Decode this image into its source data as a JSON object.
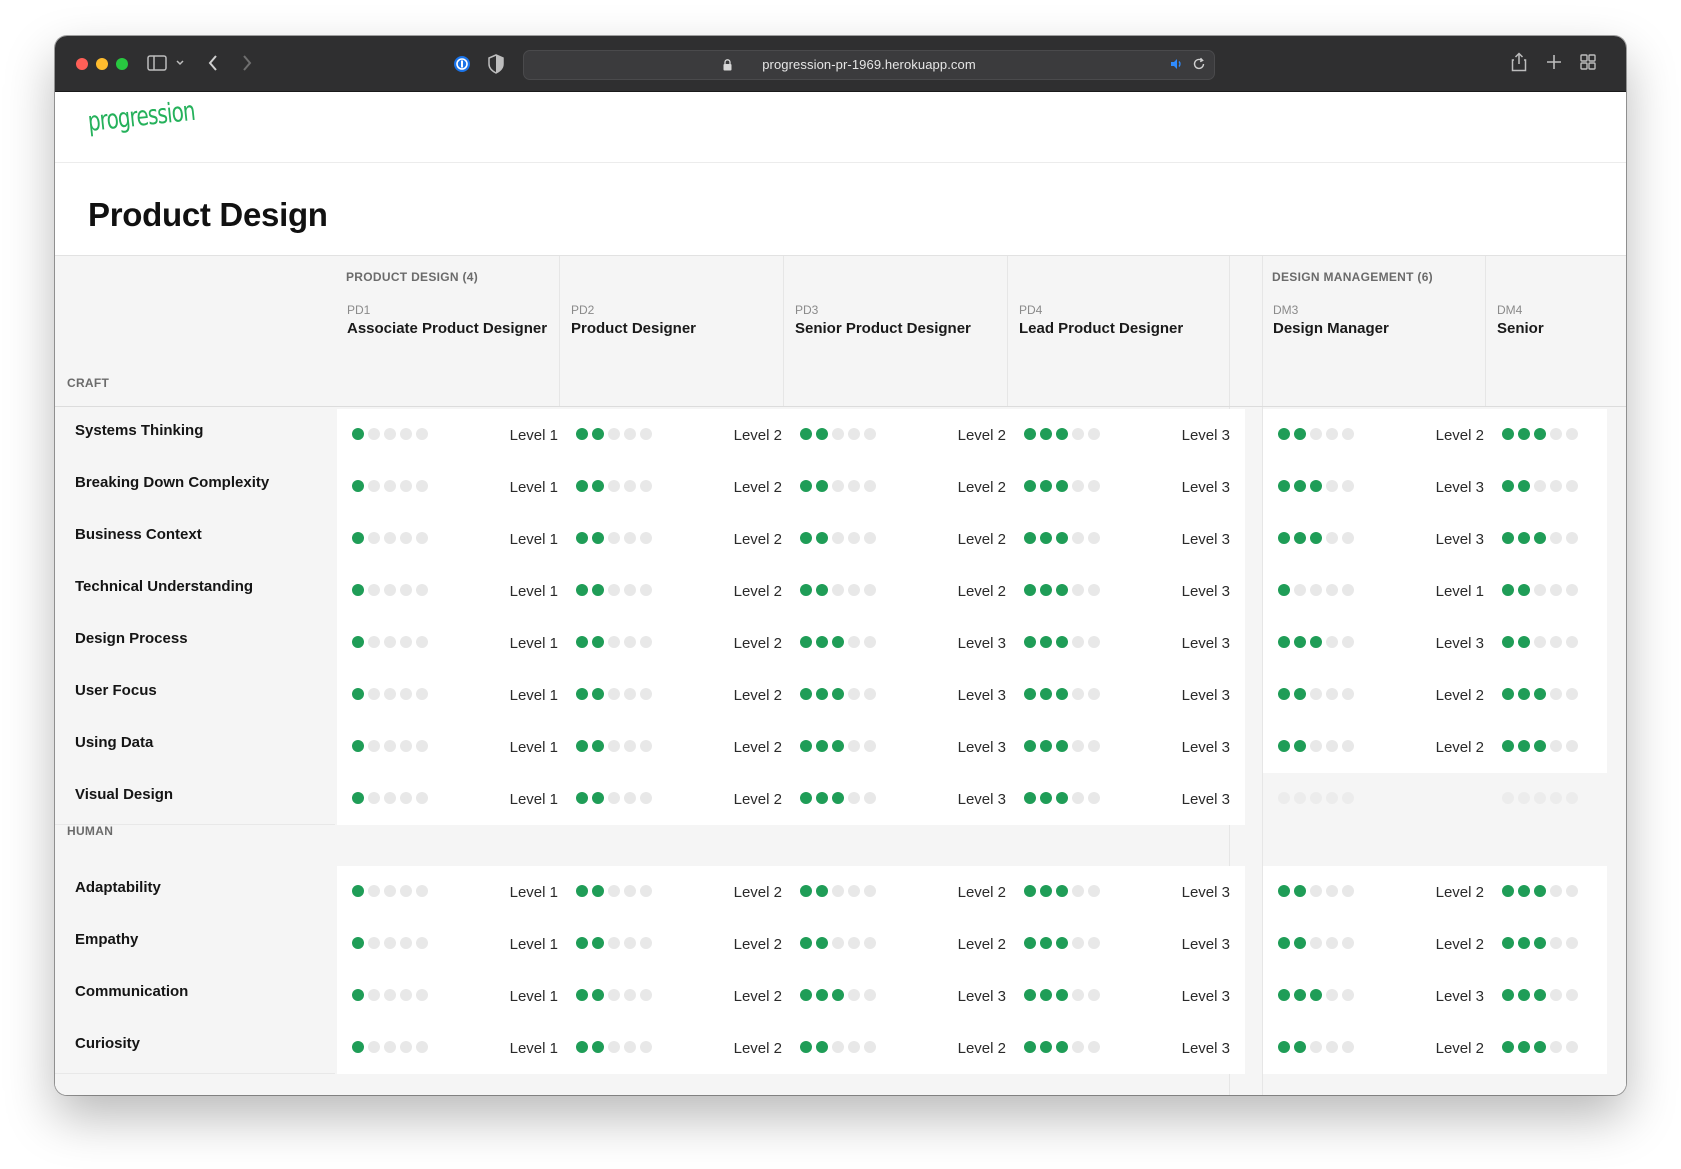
{
  "browser": {
    "url": "progression-pr-1969.herokuapp.com"
  },
  "app": {
    "logo": "progression",
    "page_title": "Product Design"
  },
  "colors": {
    "accent_green": "#1f9d57",
    "dot_off": "#e8e8e8",
    "logo_green": "#25b15b"
  },
  "groups": [
    {
      "label": "PRODUCT DESIGN (4)"
    },
    {
      "label": "DESIGN MANAGEMENT (6)"
    }
  ],
  "columns": [
    {
      "code": "PD1",
      "title": "Associate Product Designer"
    },
    {
      "code": "PD2",
      "title": "Product Designer"
    },
    {
      "code": "PD3",
      "title": "Senior Product Designer"
    },
    {
      "code": "PD4",
      "title": "Lead Product Designer"
    },
    {
      "code": "DM3",
      "title": "Design Manager"
    },
    {
      "code": "DM4",
      "title": "Senior"
    }
  ],
  "sections": [
    {
      "label": "CRAFT",
      "rows": [
        {
          "skill": "Systems Thinking",
          "levels": [
            1,
            2,
            2,
            3,
            2,
            3
          ]
        },
        {
          "skill": "Breaking Down Complexity",
          "levels": [
            1,
            2,
            2,
            3,
            3,
            2
          ]
        },
        {
          "skill": "Business Context",
          "levels": [
            1,
            2,
            2,
            3,
            3,
            3
          ]
        },
        {
          "skill": "Technical Understanding",
          "levels": [
            1,
            2,
            2,
            3,
            1,
            2
          ]
        },
        {
          "skill": "Design Process",
          "levels": [
            1,
            2,
            3,
            3,
            3,
            2
          ]
        },
        {
          "skill": "User Focus",
          "levels": [
            1,
            2,
            3,
            3,
            2,
            3
          ]
        },
        {
          "skill": "Using Data",
          "levels": [
            1,
            2,
            3,
            3,
            2,
            3
          ]
        },
        {
          "skill": "Visual Design",
          "levels": [
            1,
            2,
            3,
            3,
            0,
            0
          ]
        }
      ]
    },
    {
      "label": "HUMAN",
      "rows": [
        {
          "skill": "Adaptability",
          "levels": [
            1,
            2,
            2,
            3,
            2,
            3
          ]
        },
        {
          "skill": "Empathy",
          "levels": [
            1,
            2,
            2,
            3,
            2,
            3
          ]
        },
        {
          "skill": "Communication",
          "levels": [
            1,
            2,
            3,
            3,
            3,
            3
          ]
        },
        {
          "skill": "Curiosity",
          "levels": [
            1,
            2,
            2,
            3,
            2,
            3
          ]
        }
      ]
    }
  ],
  "level_prefix": "Level",
  "max_level": 5
}
